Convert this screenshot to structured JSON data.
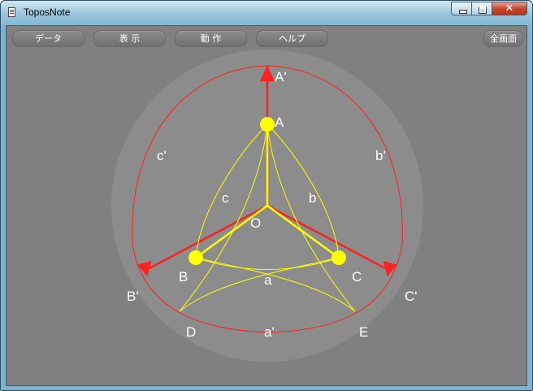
{
  "window": {
    "title": "ToposNote"
  },
  "menu": {
    "data": "データ",
    "view": "表 示",
    "action": "動 作",
    "help": "ヘルプ",
    "fullscreen": "全画面"
  },
  "labels": {
    "A_prime": "A'",
    "A": "A",
    "B_prime": "B'",
    "B": "B",
    "C_prime": "C'",
    "C": "C",
    "O": "O",
    "a": "a",
    "b": "b",
    "c": "c",
    "a_prime": "a'",
    "b_prime": "b'",
    "c_prime": "c'",
    "D": "D",
    "E": "E"
  },
  "colors": {
    "disk": "#8c8c8c",
    "background": "#808080",
    "axis": "#ff2020",
    "triangle": "#ffff00",
    "text": "#ffffff"
  }
}
